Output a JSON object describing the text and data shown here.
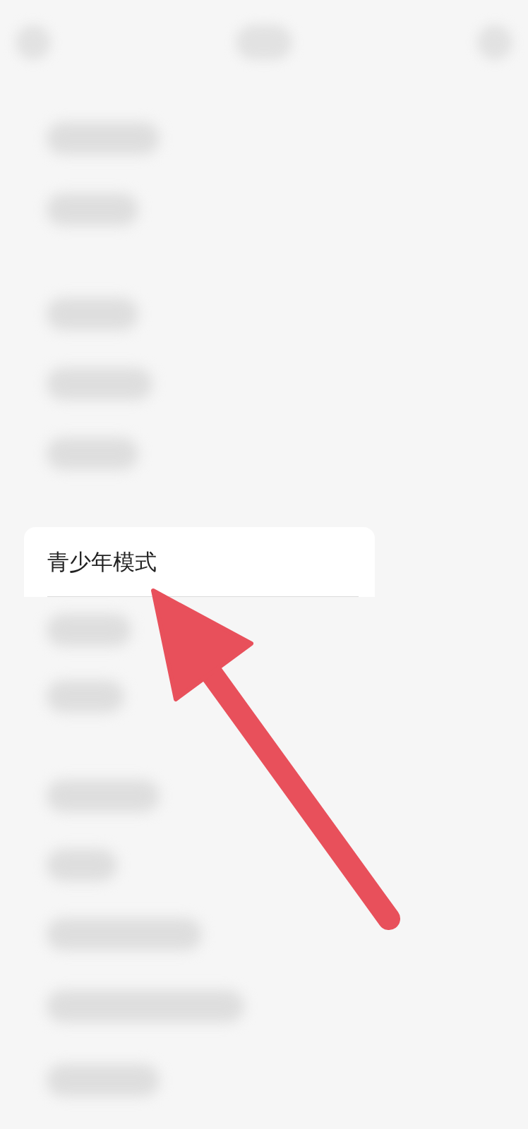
{
  "settings_item": {
    "label": "青少年模式"
  }
}
